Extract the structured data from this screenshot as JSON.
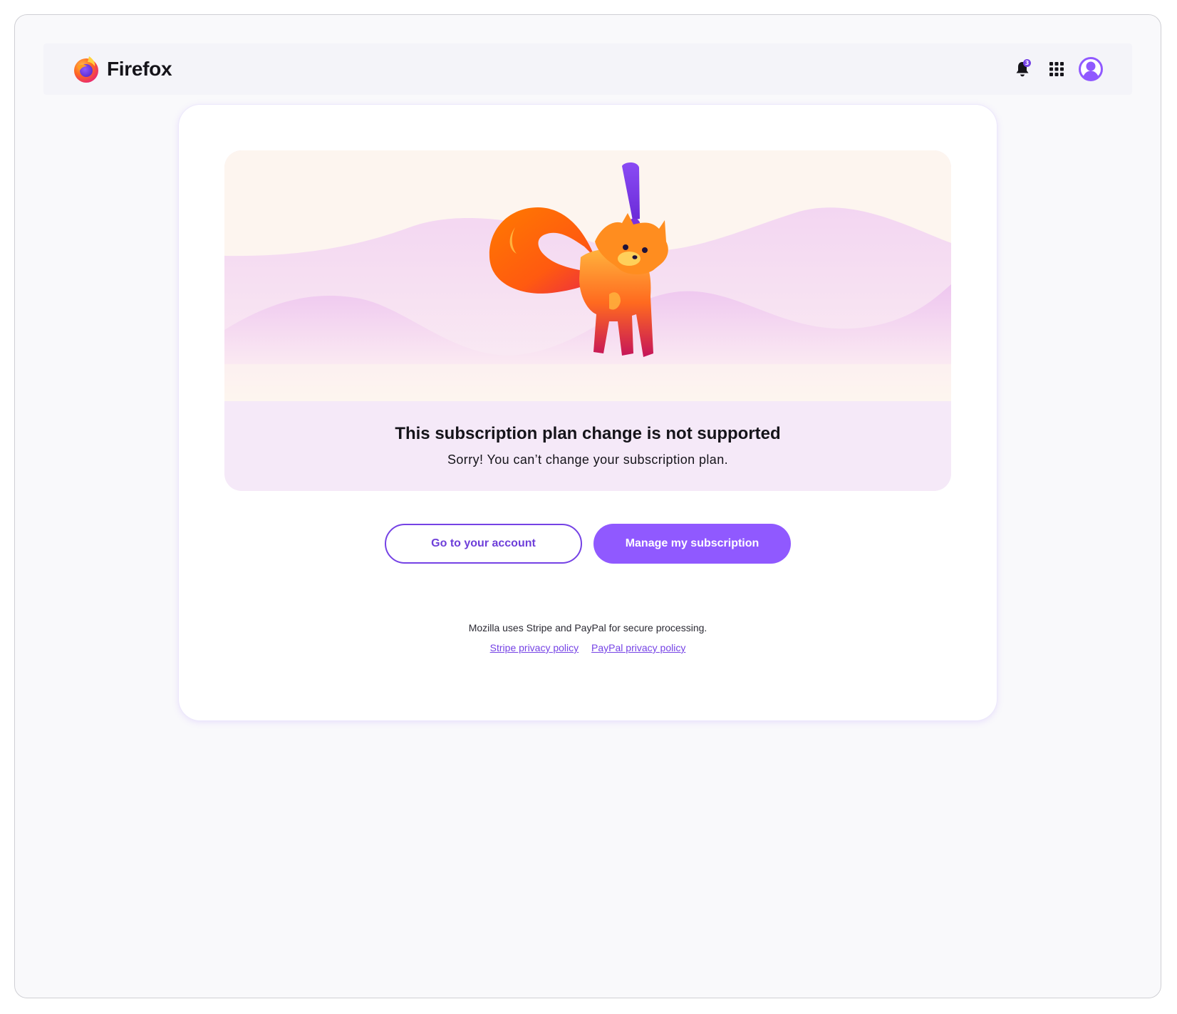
{
  "header": {
    "brand_name": "Firefox",
    "brand_logo": "firefox-logo",
    "notifications": {
      "icon": "bell-icon",
      "badge_count": "3"
    },
    "apps_icon": "grid-icon",
    "avatar_icon": "avatar-icon"
  },
  "hero": {
    "illustration": "fox-with-exclamation-mark",
    "title": "This subscription plan change is not supported",
    "subtitle": "Sorry! You can’t change your subscription plan."
  },
  "actions": {
    "go_to_account_label": "Go to your account",
    "manage_subscription_label": "Manage my subscription"
  },
  "legal": {
    "processing_note": "Mozilla uses Stripe and PayPal for secure processing.",
    "stripe_link": "Stripe privacy policy",
    "paypal_link": "PayPal privacy policy"
  },
  "colors": {
    "accent": "#9059ff",
    "accent_dark": "#7542e5",
    "page_background": "#f9f9fb",
    "hero_text_background": "#f5e9f8",
    "hero_sky": "#fdf5ef",
    "text": "#15141a"
  }
}
